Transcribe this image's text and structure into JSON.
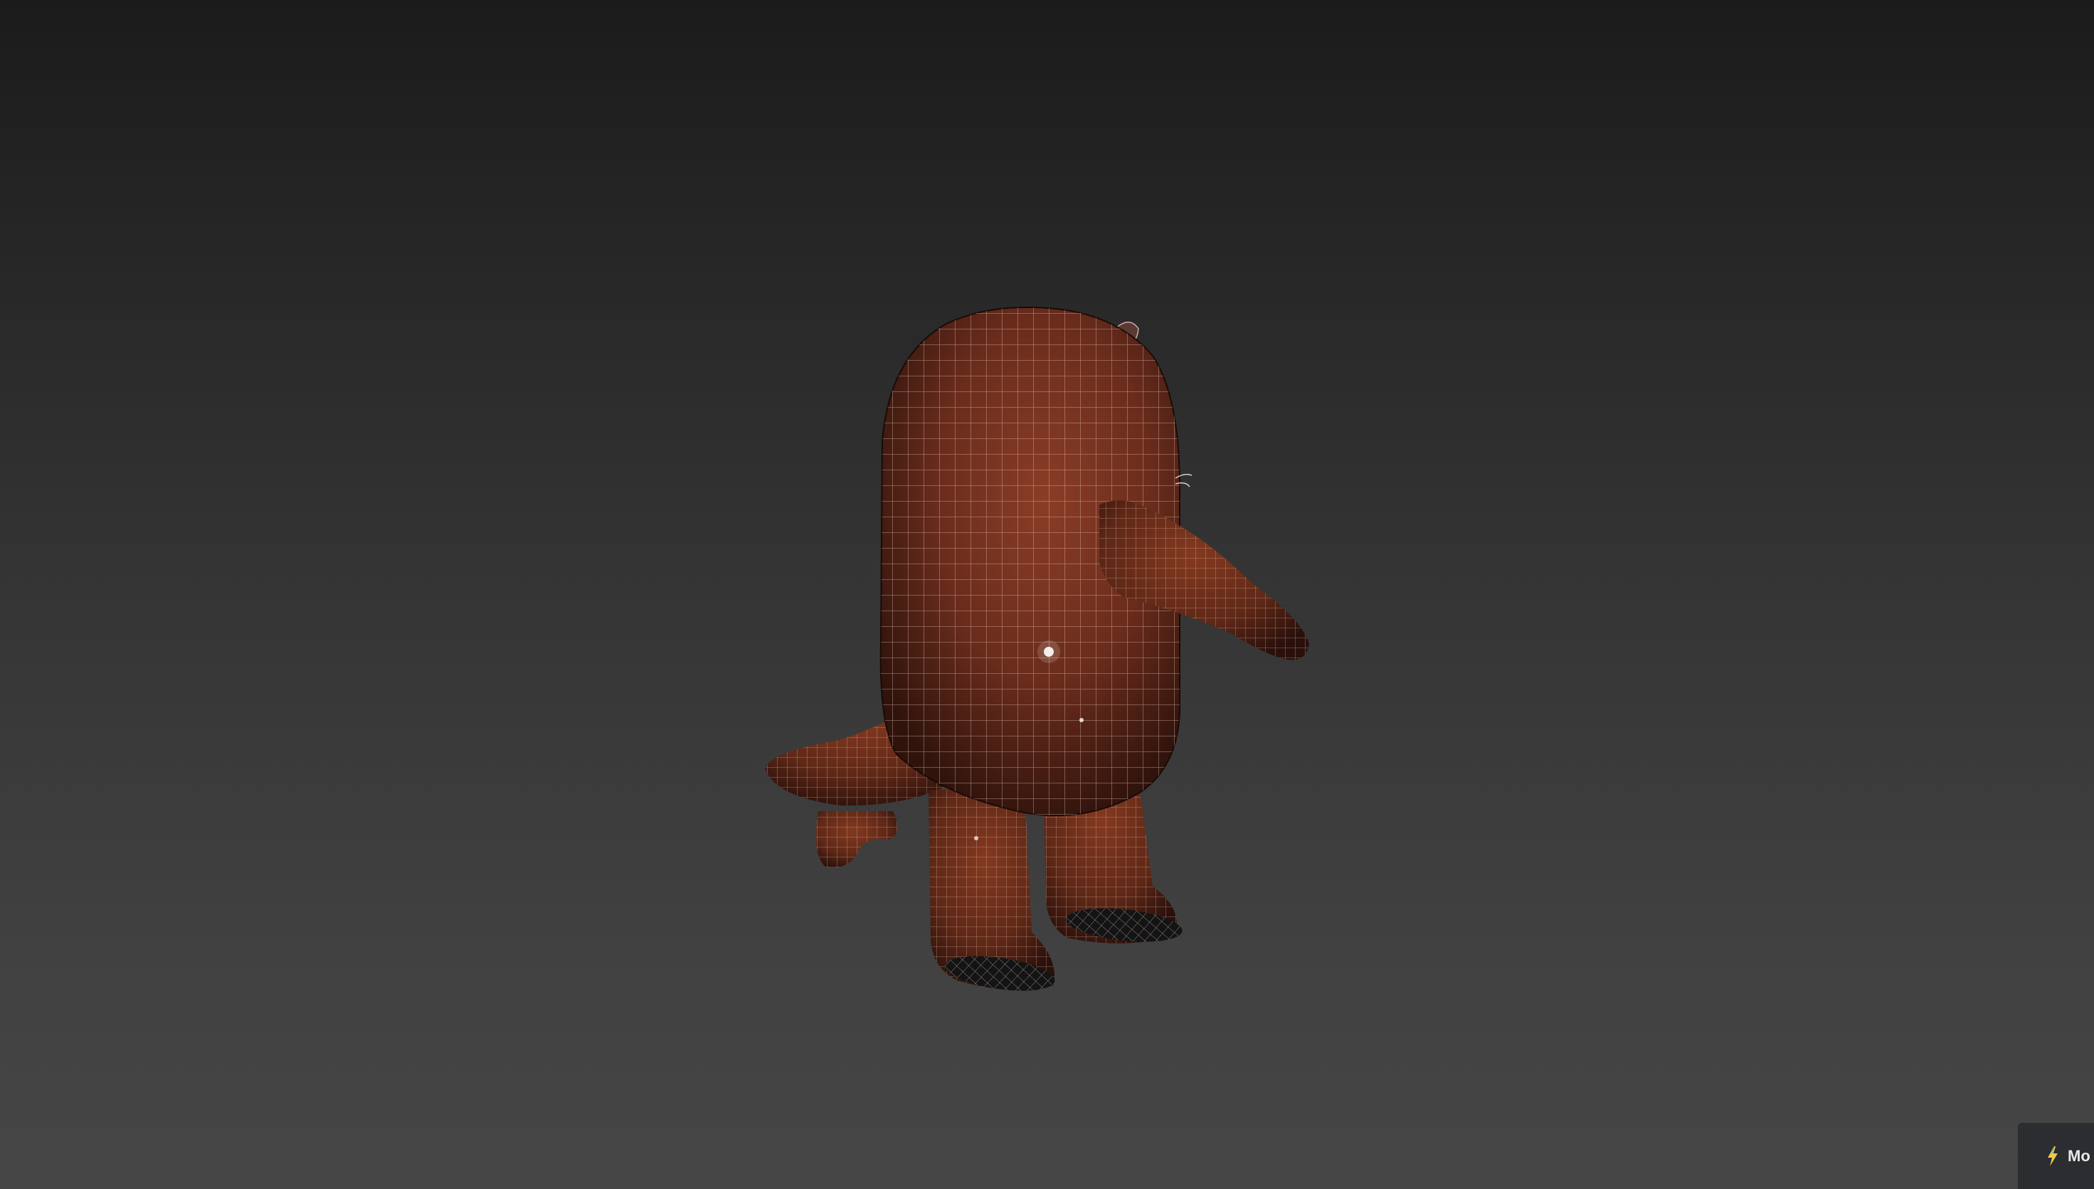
{
  "viewport": {
    "name": "3d-viewport",
    "background_top": "#1b1b1b",
    "background_bottom": "#464646"
  },
  "model": {
    "material_color": "#6a2c1c",
    "wire_color": "#e9c7b5",
    "shape": "cartoon-creature-back-view"
  },
  "corner_tab": {
    "icon": "lightning-icon",
    "label": "Mo"
  }
}
